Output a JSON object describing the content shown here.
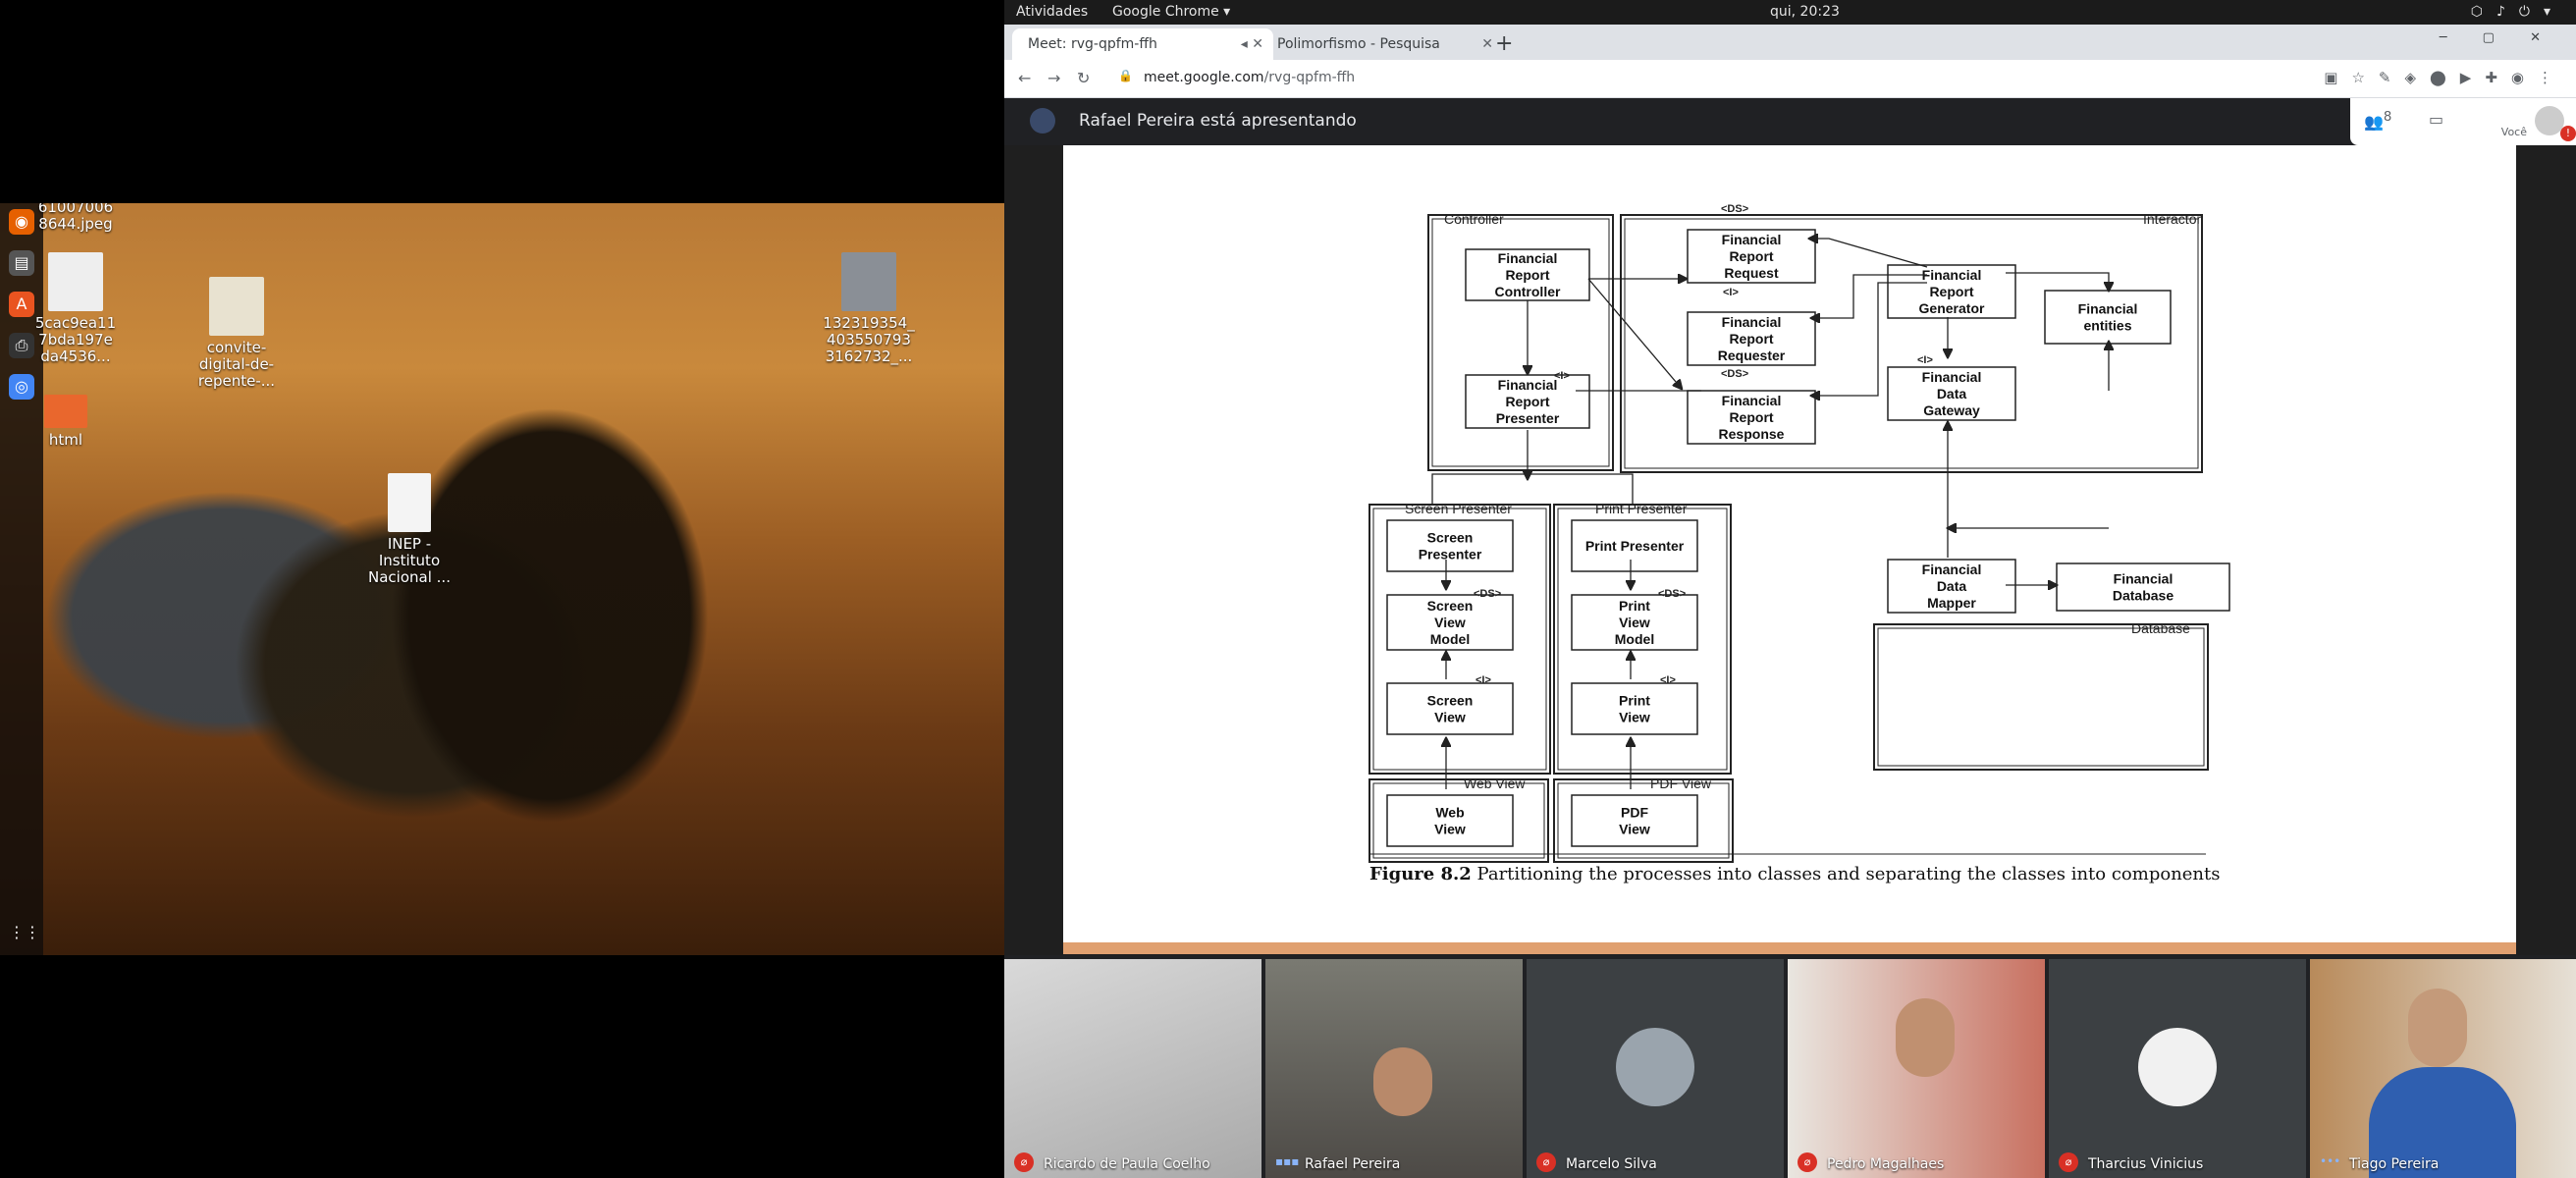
{
  "topbar": {
    "activities": "Atividades",
    "app": "Google Chrome ▾",
    "clock": "qui, 20:23",
    "tray_icons": [
      "network-icon",
      "volume-icon",
      "power-icon",
      "chevron-down-icon"
    ]
  },
  "desktop": {
    "icons": [
      {
        "label": "61007006\n8644.jpeg"
      },
      {
        "label": "5cac9ea11\n7bda197e\nda4536..."
      },
      {
        "label": "convite-\ndigital-de-\nrepente-..."
      },
      {
        "label": "132319354_\n403550793\n3162732_..."
      },
      {
        "label": "html"
      },
      {
        "label": "INEP -\nInstituto\nNacional ..."
      }
    ],
    "dock": [
      "firefox-icon",
      "files-icon",
      "software-icon",
      "printer-icon",
      "chrome-icon",
      "apps-grid-icon"
    ]
  },
  "browser": {
    "tabs": [
      {
        "label": "Meet: rvg-qpfm-ffh",
        "active": true
      },
      {
        "label": "Polimorfismo - Pesquisa",
        "active": false
      }
    ],
    "url_host": "meet.google.com",
    "url_path": "/rvg-qpfm-ffh"
  },
  "meet": {
    "presenting": "Rafael Pereira está apresentando",
    "people_count": "8",
    "you_label": "Você",
    "alert": "!"
  },
  "figure": {
    "boxes": {
      "controller": "Controller",
      "interactor": "Interactor",
      "screen_presenter_group": "Screen Presenter",
      "print_presenter_group": "Print Presenter",
      "database": "Database",
      "web_view_group": "Web View",
      "pdf_view_group": "PDF View"
    },
    "nodes": {
      "frc": [
        "Financial",
        "Report",
        "Controller"
      ],
      "frp": [
        "Financial",
        "Report",
        "Presenter"
      ],
      "frreq": [
        "Financial",
        "Report",
        "Request"
      ],
      "frreqr": [
        "Financial",
        "Report",
        "Requester"
      ],
      "frresp": [
        "Financial",
        "Report",
        "Response"
      ],
      "frg": [
        "Financial",
        "Report",
        "Generator"
      ],
      "fe": [
        "Financial",
        "entities"
      ],
      "fdg": [
        "Financial",
        "Data",
        "Gateway"
      ],
      "fdm": [
        "Financial",
        "Data",
        "Mapper"
      ],
      "fdb": [
        "Financial",
        "Database"
      ],
      "sp": [
        "Screen",
        "Presenter"
      ],
      "svm": [
        "Screen",
        "View",
        "Model"
      ],
      "sv": [
        "Screen",
        "View"
      ],
      "pp": [
        "Print Presenter"
      ],
      "pvm": [
        "Print",
        "View",
        "Model"
      ],
      "pv": [
        "Print",
        "View"
      ],
      "wv": [
        "Web",
        "View"
      ],
      "pdfv": [
        "PDF",
        "View"
      ]
    },
    "stereo": {
      "ds": "<DS>",
      "i": "<I>"
    },
    "caption_bold": "Figure 8.2",
    "caption_text": "Partitioning the processes into classes and separating the classes into components"
  },
  "participants": [
    {
      "name": "Ricardo de Paula Coelho",
      "mic": "muted"
    },
    {
      "name": "Rafael Pereira",
      "mic": "speaking"
    },
    {
      "name": "Marcelo Silva",
      "mic": "muted"
    },
    {
      "name": "Pedro Magalhaes",
      "mic": "muted"
    },
    {
      "name": "Tharcius Vinicius",
      "mic": "muted"
    },
    {
      "name": "Tiago Pereira",
      "mic": "speaking"
    }
  ],
  "colors": {
    "meet_dark": "#202124",
    "muted_red": "#d93025",
    "slide_bar": "#e0a070"
  }
}
